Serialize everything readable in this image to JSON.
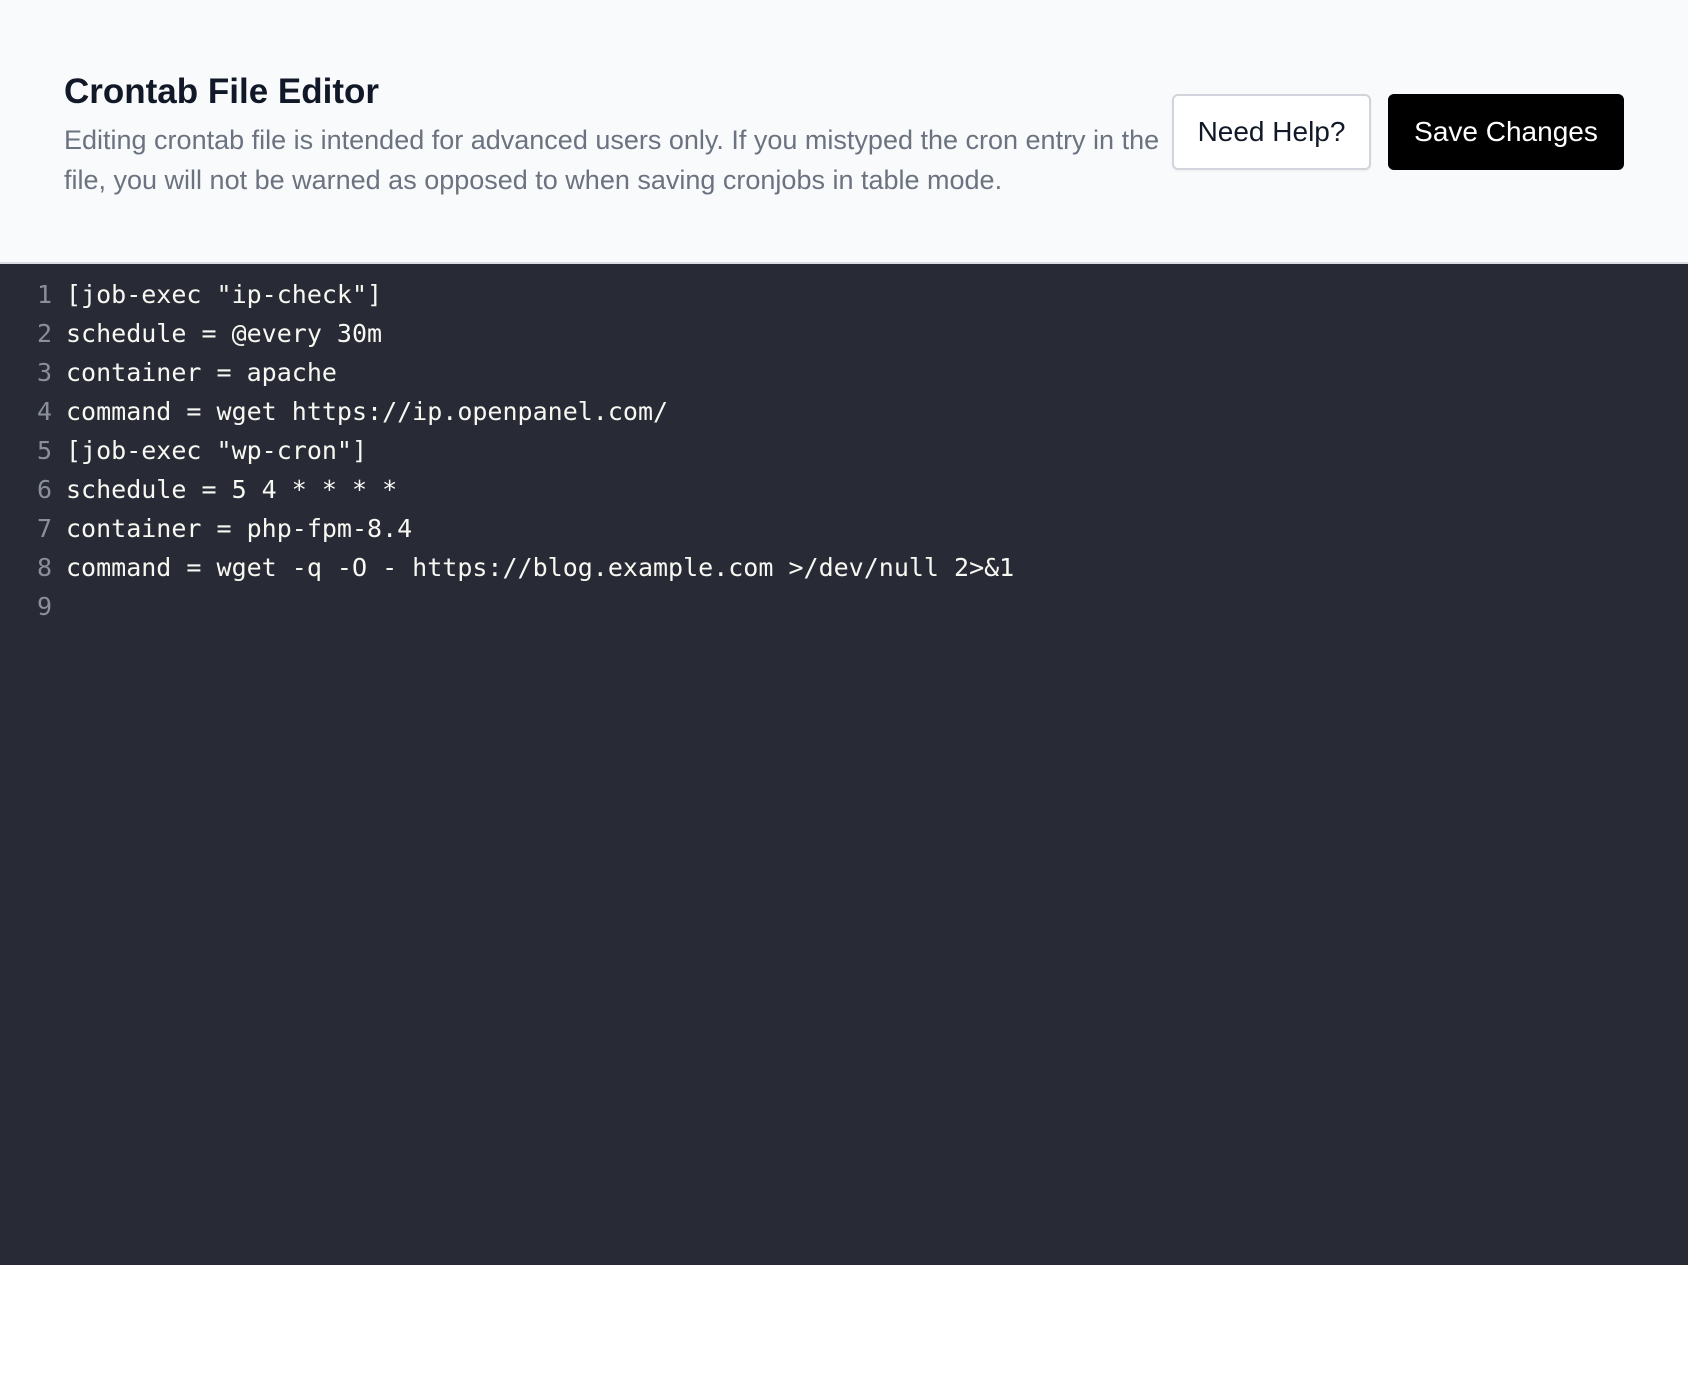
{
  "header": {
    "title": "Crontab File Editor",
    "description": "Editing crontab file is intended for advanced users only. If you mistyped the cron entry in the file, you will not be warned as opposed to when saving cronjobs in table mode.",
    "help_label": "Need Help?",
    "save_label": "Save Changes"
  },
  "editor": {
    "lines": [
      {
        "num": "1",
        "text": "[job-exec \"ip-check\"]"
      },
      {
        "num": "2",
        "text": "schedule = @every 30m"
      },
      {
        "num": "3",
        "text": "container = apache"
      },
      {
        "num": "4",
        "text": "command = wget https://ip.openpanel.com/"
      },
      {
        "num": "5",
        "text": "[job-exec \"wp-cron\"]"
      },
      {
        "num": "6",
        "text": "schedule = 5 4 * * * *"
      },
      {
        "num": "7",
        "text": "container = php-fpm-8.4"
      },
      {
        "num": "8",
        "text": "command = wget -q -O - https://blog.example.com >/dev/null 2>&1"
      },
      {
        "num": "9",
        "text": ""
      }
    ]
  },
  "colors": {
    "editor_background": "#282a36",
    "save_button_background": "#000000",
    "header_background": "#f9fafb"
  }
}
